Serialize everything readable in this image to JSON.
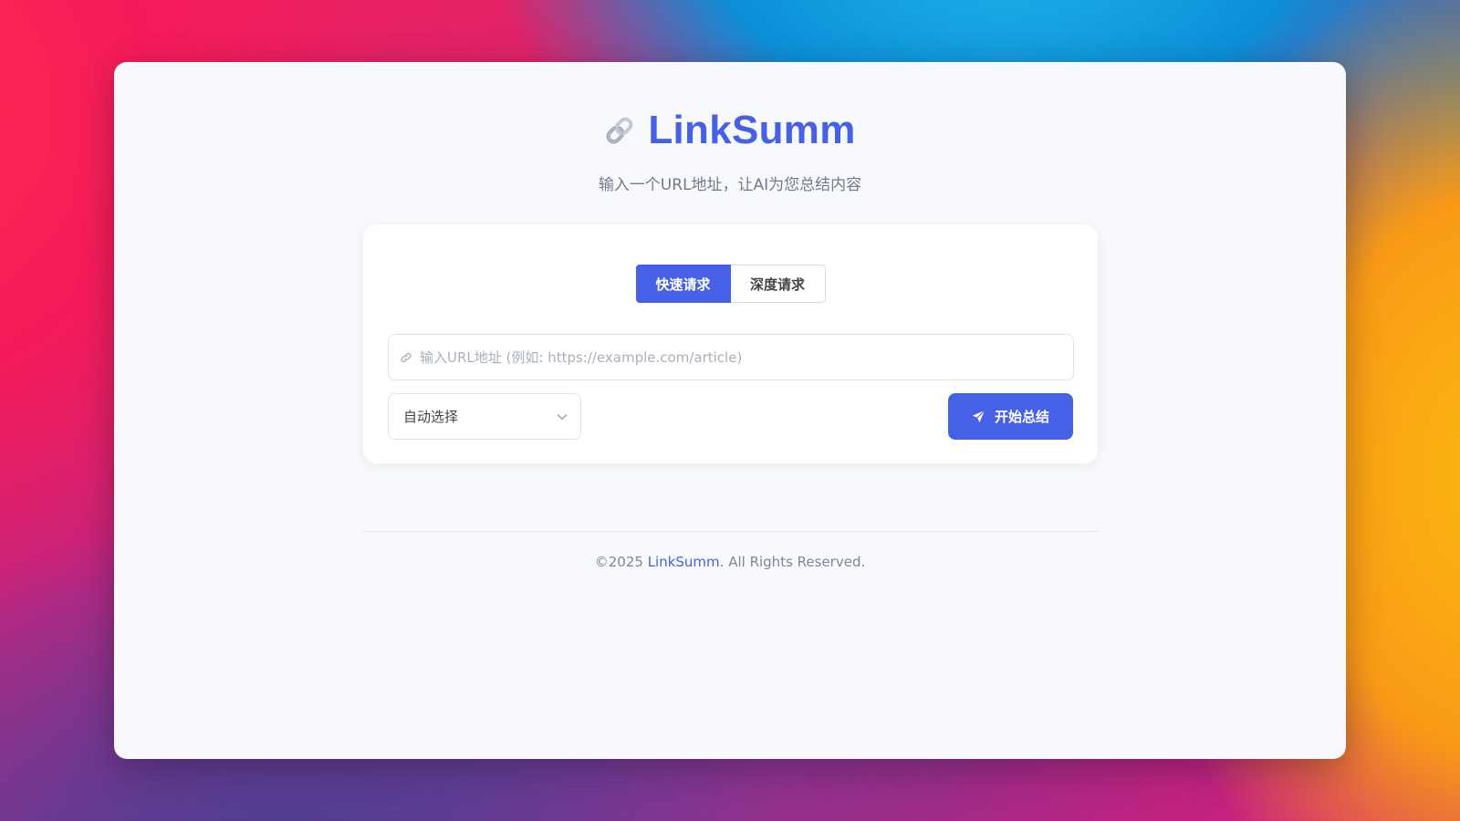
{
  "app": {
    "title": "LinkSumm",
    "subtitle": "输入一个URL地址，让AI为您总结内容",
    "icon": "chain-link-icon"
  },
  "tabs": [
    {
      "label": "快速请求",
      "active": true
    },
    {
      "label": "深度请求",
      "active": false
    }
  ],
  "url_input": {
    "value": "",
    "placeholder": "输入URL地址 (例如: https://example.com/article)",
    "icon": "link-icon"
  },
  "model_select": {
    "selected": "自动选择",
    "icon": "chevron-down-icon"
  },
  "submit": {
    "label": "开始总结",
    "icon": "send-icon"
  },
  "footer": {
    "prefix": "©2025 ",
    "brand": "LinkSumm",
    "suffix": ". All Rights Reserved."
  },
  "colors": {
    "accent": "#4761e6",
    "window_bg": "#f7f9fd",
    "card_bg": "#ffffff",
    "muted_text": "#6f7b89"
  }
}
